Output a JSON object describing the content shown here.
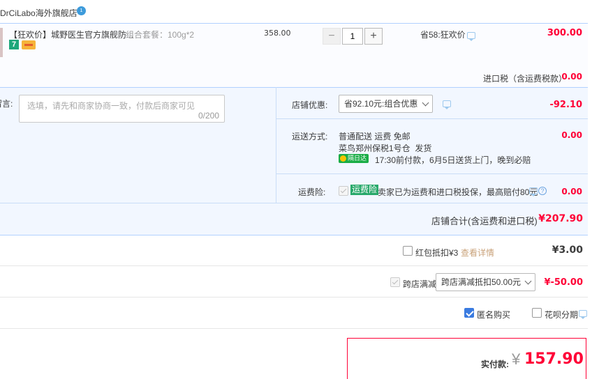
{
  "shop": {
    "name": "DrCiLabo海外旗舰店",
    "badge": "1"
  },
  "item": {
    "title": "【狂欢价】城野医生官方旗舰防...",
    "spec": "组合套餐：100g*2",
    "unit_price": "358.00",
    "quantity": "1",
    "saving": "省58:狂欢价",
    "total": "300.00",
    "badges": [
      "7"
    ]
  },
  "import_tax": {
    "label": "进口税（含运费税款）",
    "value": "0.00"
  },
  "message": {
    "label": "留言:",
    "placeholder": "选填，请先和商家协商一致，付款后商家可见",
    "counter": "0/200"
  },
  "shop_discount": {
    "label": "店铺优惠:",
    "selected": "省92.10元:组合优惠",
    "value": "-92.10"
  },
  "shipping": {
    "label": "运送方式:",
    "method": "普通配送 运费 免邮",
    "warehouse": "菜鸟郑州保税1号仓  发货",
    "tag": "隔日达",
    "eta": "17:30前付款，6月5日送货上门，晚到必赔",
    "value": "0.00"
  },
  "insurance": {
    "label": "运费险:",
    "tag": "运费险",
    "text": "卖家已为运费和进口税投保，最高赔付80元",
    "value": "0.00"
  },
  "shop_total": {
    "label": "店铺合计(含运费和进口税)",
    "value": "¥207.90"
  },
  "red_packet": {
    "label": "红包抵扣¥3",
    "link": "查看详情",
    "value": "¥3.00"
  },
  "cross_store": {
    "label": "跨店满减",
    "selected": "跨店满减抵扣50.00元",
    "value": "¥-50.00"
  },
  "anonymous": {
    "label": "匿名购买"
  },
  "installment": {
    "label": "花呗分期"
  },
  "payment": {
    "label": "实付款:",
    "currency": "¥",
    "value": "157.90"
  }
}
